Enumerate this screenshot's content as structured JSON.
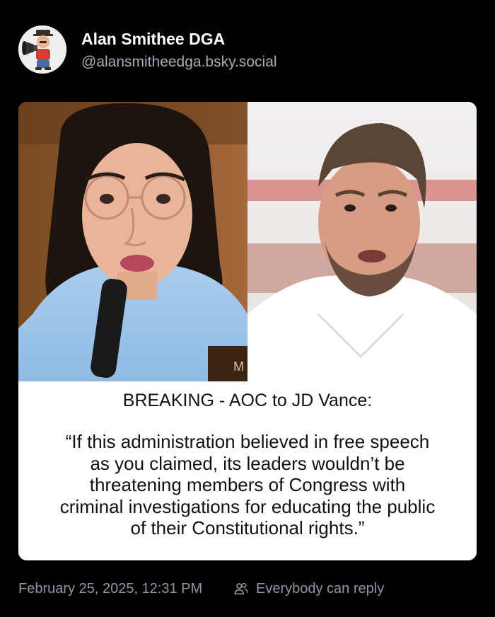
{
  "author": {
    "display_name": "Alan Smithee DGA",
    "handle": "@alansmitheedga.bsky.social"
  },
  "embed": {
    "headline": "BREAKING - AOC to JD Vance:",
    "quote_lines": [
      "“If this administration believed in free speech",
      "as you claimed, its leaders wouldn’t be",
      "threatening members of Congress with",
      "criminal investigations for educating the public",
      "of their Constitutional rights.”"
    ],
    "podium_sign_text": "M"
  },
  "footer": {
    "timestamp": "February 25, 2025, 12:31 PM",
    "reply_setting": "Everybody can reply"
  },
  "icons": {
    "avatar": "avatar-megaphone-man",
    "reply": "people-icon"
  },
  "colors": {
    "background": "#000000",
    "name": "#ffffff",
    "handle": "#a3adba",
    "muted": "#8c97a5"
  }
}
